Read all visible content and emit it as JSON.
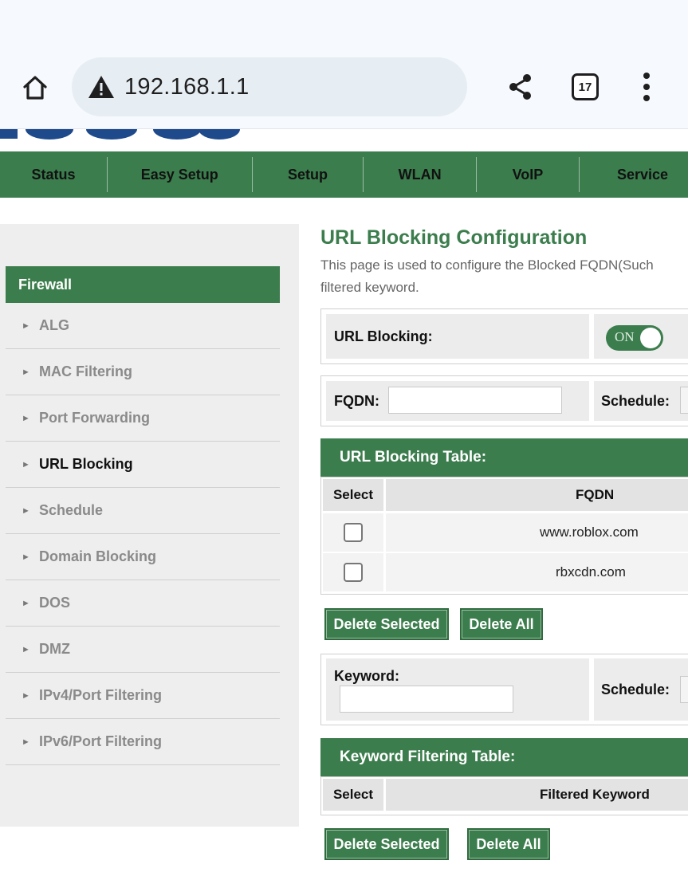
{
  "browser": {
    "url": "192.168.1.1",
    "tab_count": "17"
  },
  "nav": {
    "items": [
      "Status",
      "Easy Setup",
      "Setup",
      "WLAN",
      "VoIP",
      "Service"
    ]
  },
  "sidebar": {
    "header": "Firewall",
    "items": [
      {
        "label": "ALG",
        "active": false
      },
      {
        "label": "MAC Filtering",
        "active": false
      },
      {
        "label": "Port Forwarding",
        "active": false
      },
      {
        "label": "URL Blocking",
        "active": true
      },
      {
        "label": "Schedule",
        "active": false
      },
      {
        "label": "Domain Blocking",
        "active": false
      },
      {
        "label": "DOS",
        "active": false
      },
      {
        "label": "DMZ",
        "active": false
      },
      {
        "label": "IPv4/Port Filtering",
        "active": false
      },
      {
        "label": "IPv6/Port Filtering",
        "active": false
      }
    ]
  },
  "main": {
    "title": "URL Blocking Configuration",
    "description": "This page is used to configure the Blocked FQDN(Such filtered keyword.",
    "url_blocking": {
      "label": "URL Blocking:",
      "toggle_text": "ON",
      "enabled": true
    },
    "fqdn_form": {
      "fqdn_label": "FQDN:",
      "fqdn_value": "",
      "schedule_label": "Schedule:"
    },
    "url_table": {
      "title": "URL Blocking Table:",
      "columns": [
        "Select",
        "FQDN"
      ],
      "rows": [
        {
          "checked": false,
          "fqdn": "www.roblox.com"
        },
        {
          "checked": false,
          "fqdn": "rbxcdn.com"
        }
      ]
    },
    "url_buttons": {
      "delete_selected": "Delete Selected",
      "delete_all": "Delete All"
    },
    "keyword_form": {
      "keyword_label": "Keyword:",
      "keyword_value": "",
      "schedule_label": "Schedule:"
    },
    "keyword_table": {
      "title": "Keyword Filtering Table:",
      "columns": [
        "Select",
        "Filtered Keyword"
      ]
    },
    "keyword_buttons": {
      "delete_selected": "Delete Selected",
      "delete_all": "Delete All"
    }
  },
  "colors": {
    "brand_green": "#3c7d4d",
    "sidebar_bg": "#eeeeee",
    "chrome_bg": "#f6f9fd"
  }
}
